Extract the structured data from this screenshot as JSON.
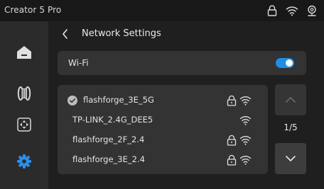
{
  "app": {
    "title": "Creator 5 Pro"
  },
  "header": {
    "title": "Network Settings"
  },
  "wifi": {
    "label": "Wi-Fi",
    "enabled": true
  },
  "networks": [
    {
      "name": "flashforge_3E_5G",
      "connected": true,
      "locked": true
    },
    {
      "name": "TP-LINK_2.4G_DEE5",
      "connected": false,
      "locked": false
    },
    {
      "name": "flashforge_2F_2.4",
      "connected": false,
      "locked": true
    },
    {
      "name": "flashforge_3E_2.4",
      "connected": false,
      "locked": true
    }
  ],
  "pagination": {
    "label": "1/5"
  },
  "sidebar": {
    "items": [
      {
        "icon": "home-icon",
        "active": false
      },
      {
        "icon": "filament-spool-icon",
        "active": false
      },
      {
        "icon": "move-axis-icon",
        "active": false
      },
      {
        "icon": "settings-gear-icon",
        "active": true
      }
    ]
  },
  "colors": {
    "accent": "#1e8fe6",
    "background": "#1f1f1f",
    "panel": "#333333",
    "sidebar": "#2b2b2b"
  }
}
